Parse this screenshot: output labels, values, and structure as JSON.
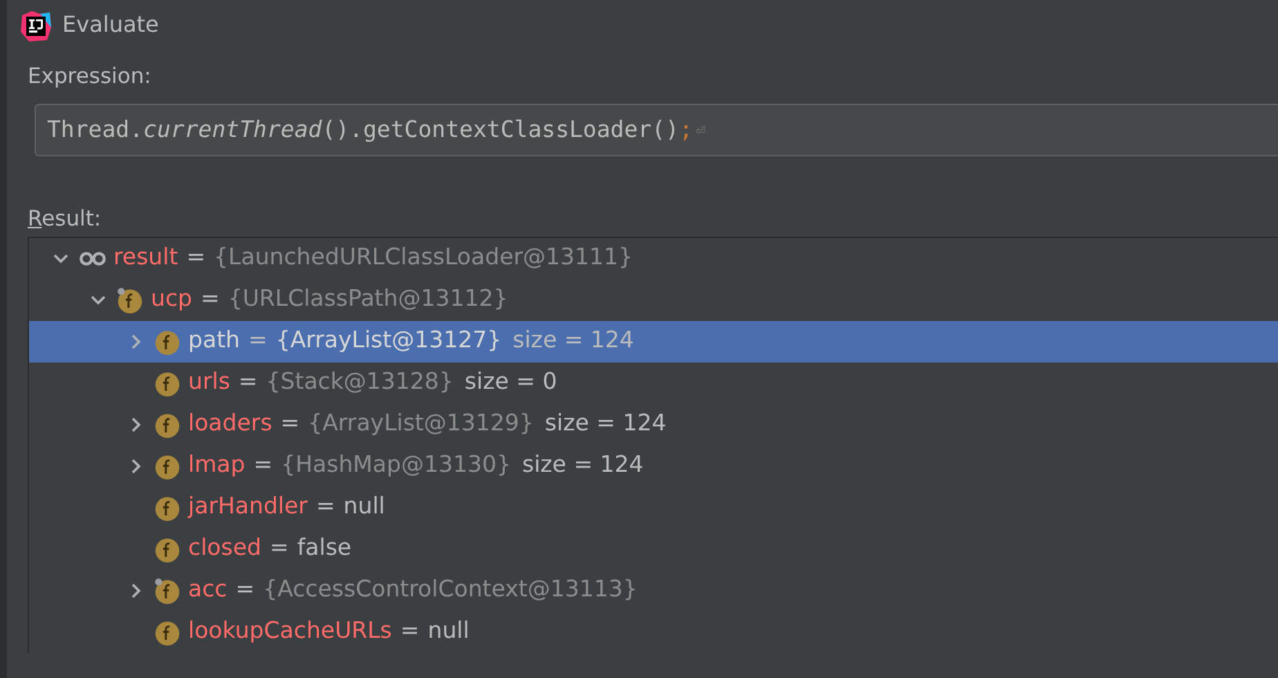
{
  "window": {
    "title": "Evaluate"
  },
  "expression": {
    "label": "Expression:",
    "code": "Thread.*currentThread*().getContextClassLoader()",
    "terminator": ";",
    "line_end": "⏎"
  },
  "result": {
    "label": "Result:",
    "tree": [
      {
        "kind": "watch",
        "name": "result",
        "equals": "=",
        "value": "{LaunchedURLClassLoader@13111}",
        "expandable": true,
        "expanded": true,
        "selected": false,
        "marked": false,
        "children": [
          {
            "kind": "field",
            "name": "ucp",
            "equals": "=",
            "value": "{URLClassPath@13112}",
            "expandable": true,
            "expanded": true,
            "selected": false,
            "marked": true,
            "children": [
              {
                "kind": "field",
                "name": "path",
                "equals": "=",
                "value": "{ArrayList@13127}",
                "size": "size = 124",
                "expandable": true,
                "expanded": false,
                "selected": true,
                "marked": false
              },
              {
                "kind": "field",
                "name": "urls",
                "equals": "=",
                "value": "{Stack@13128}",
                "size": "size = 0",
                "expandable": false,
                "expanded": false,
                "selected": false,
                "marked": false
              },
              {
                "kind": "field",
                "name": "loaders",
                "equals": "=",
                "value": "{ArrayList@13129}",
                "size": "size = 124",
                "expandable": true,
                "expanded": false,
                "selected": false,
                "marked": false
              },
              {
                "kind": "field",
                "name": "lmap",
                "equals": "=",
                "value": "{HashMap@13130}",
                "size": "size = 124",
                "expandable": true,
                "expanded": false,
                "selected": false,
                "marked": false
              },
              {
                "kind": "field",
                "name": "jarHandler",
                "equals": "=",
                "value": "null",
                "expandable": false,
                "expanded": false,
                "selected": false,
                "marked": false
              },
              {
                "kind": "field",
                "name": "closed",
                "equals": "=",
                "value": "false",
                "expandable": false,
                "expanded": false,
                "selected": false,
                "marked": false
              },
              {
                "kind": "field",
                "name": "acc",
                "equals": "=",
                "value": "{AccessControlContext@13113}",
                "expandable": true,
                "expanded": false,
                "selected": false,
                "marked": true
              },
              {
                "kind": "field",
                "name": "lookupCacheURLs",
                "equals": "=",
                "value": "null",
                "expandable": false,
                "expanded": false,
                "selected": false,
                "marked": false
              }
            ]
          }
        ]
      }
    ]
  }
}
